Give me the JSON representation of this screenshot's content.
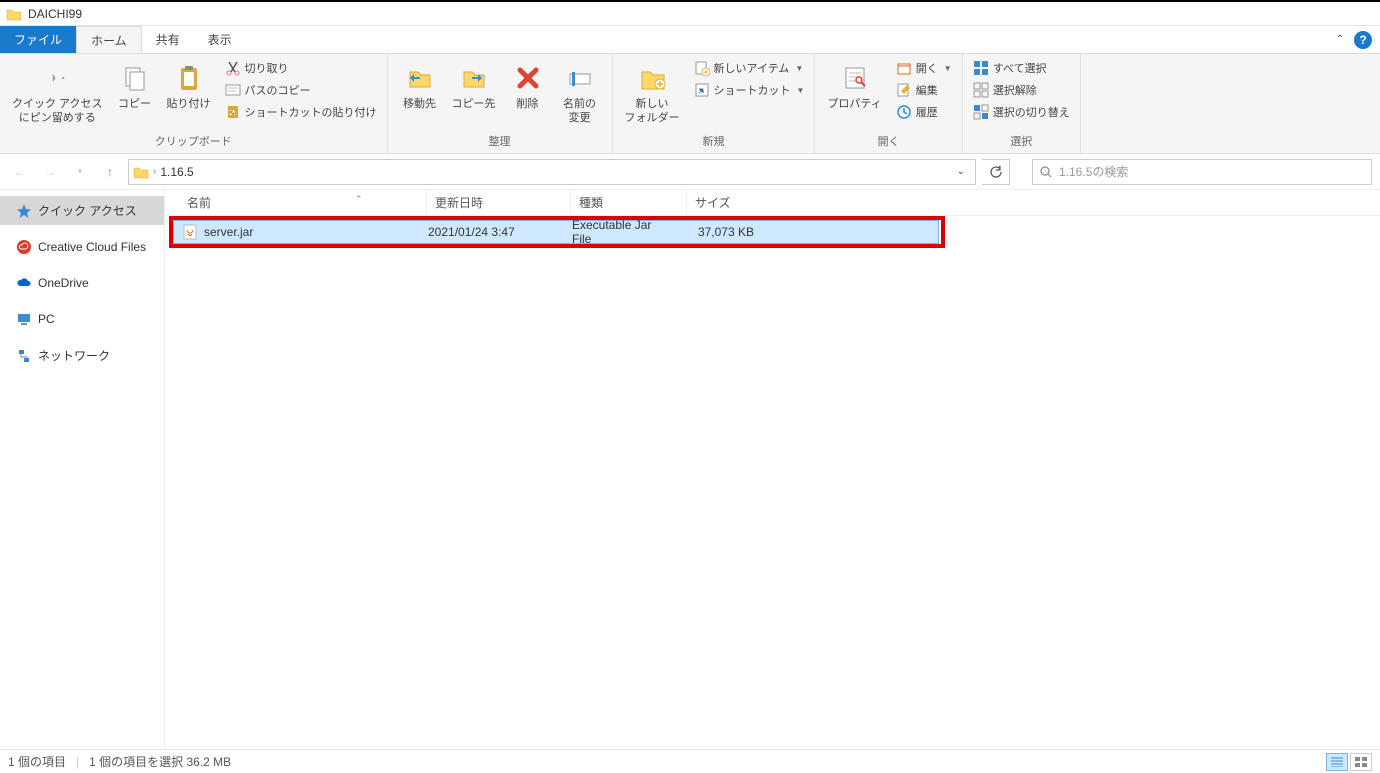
{
  "title": "DAICHI99",
  "tabs": {
    "file": "ファイル",
    "home": "ホーム",
    "share": "共有",
    "view": "表示"
  },
  "ribbon": {
    "clipboard": {
      "pin": "クイック アクセス\nにピン留めする",
      "copy": "コピー",
      "paste": "貼り付け",
      "cut": "切り取り",
      "copypath": "パスのコピー",
      "shortcut": "ショートカットの貼り付け",
      "label": "クリップボード"
    },
    "organize": {
      "move": "移動先",
      "copyto": "コピー先",
      "delete": "削除",
      "rename": "名前の\n変更",
      "label": "整理"
    },
    "new": {
      "folder": "新しい\nフォルダー",
      "item": "新しいアイテム",
      "easy": "ショートカット",
      "label": "新規"
    },
    "open": {
      "props": "プロパティ",
      "open": "開く",
      "edit": "編集",
      "history": "履歴",
      "label": "開く"
    },
    "select": {
      "all": "すべて選択",
      "none": "選択解除",
      "invert": "選択の切り替え",
      "label": "選択"
    }
  },
  "nav": {
    "path": "1.16.5",
    "search_placeholder": "1.16.5の検索"
  },
  "sidebar": {
    "quick": "クイック アクセス",
    "creative": "Creative Cloud Files",
    "onedrive": "OneDrive",
    "pc": "PC",
    "network": "ネットワーク"
  },
  "columns": {
    "name": "名前",
    "date": "更新日時",
    "type": "種類",
    "size": "サイズ"
  },
  "file": {
    "name": "server.jar",
    "date": "2021/01/24 3:47",
    "type": "Executable Jar File",
    "size": "37,073 KB"
  },
  "status": {
    "count": "1 個の項目",
    "selected": "1 個の項目を選択 36.2 MB"
  }
}
